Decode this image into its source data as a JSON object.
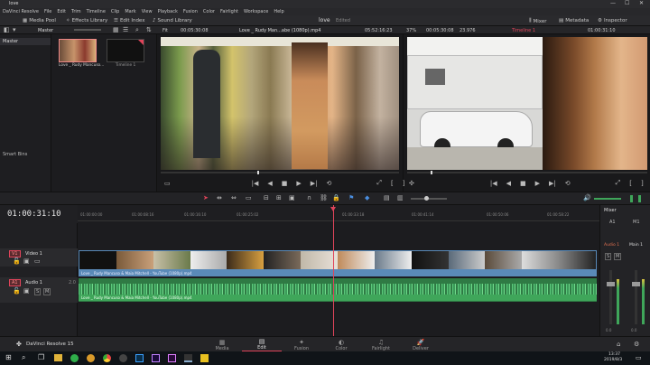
{
  "window": {
    "title": "love",
    "controls": [
      "—",
      "☐",
      "✕"
    ]
  },
  "menu": [
    "DaVinci Resolve",
    "File",
    "Edit",
    "Trim",
    "Timeline",
    "Clip",
    "Mark",
    "View",
    "Playback",
    "Fusion",
    "Color",
    "Fairlight",
    "Workspace",
    "Help"
  ],
  "toolbar": {
    "media_pool": "Media Pool",
    "effects_library": "Effects Library",
    "edit_index": "Edit Index",
    "sound_library": "Sound Library",
    "project_name": "love",
    "project_status": "Edited",
    "mixer": "Mixer",
    "metadata": "Metadata",
    "inspector": "Inspector"
  },
  "media_pool": {
    "bin_name": "Master",
    "bins": [
      "Master"
    ],
    "smart_bins": "Smart Bins",
    "clips": [
      {
        "name": "Love _ Rudy Mancuso..."
      },
      {
        "name": "Timeline 1"
      }
    ]
  },
  "source_viewer": {
    "zoom": "Fit",
    "timecode_left": "00:05:30:08",
    "clip_name": "Love _ Rudy Man...abe (1080p).mp4",
    "timecode_right": "05:52:16:23"
  },
  "program_viewer": {
    "zoom": "37%",
    "timecode_left": "00:05:30:08",
    "fps": "23.976",
    "timeline_name": "Timeline 1",
    "timecode_right": "01:00:31:10"
  },
  "timeline": {
    "timecode": "01:00:31:10",
    "ruler_ticks": [
      "01:00:00:00",
      "01:00:08:16",
      "01:00:16:10",
      "01:00:25:02",
      "01:00:33:18",
      "01:00:41:14",
      "01:00:50:06",
      "01:00:58:22"
    ],
    "video_track": {
      "id": "V1",
      "name": "Video 1",
      "clip_label": "Love _ Rudy Mancuso & Maia Mitchell - YouTube (1080p).mp4"
    },
    "audio_track": {
      "id": "A1",
      "name": "Audio 1",
      "level": "2.0",
      "clip_label": "Love _ Rudy Mancuso & Maia Mitchell - YouTube (1080p).mp4"
    }
  },
  "mixer": {
    "title": "Mixer",
    "a1": "A1",
    "m1": "M1",
    "audio1": "Audio 1",
    "main1": "Main 1",
    "value": "0.0"
  },
  "pages": [
    "Media",
    "Edit",
    "Fusion",
    "Color",
    "Fairlight",
    "Deliver"
  ],
  "active_page": "Edit",
  "branding": "DaVinci Resolve 15",
  "taskbar": {
    "time": "13:37",
    "date": "2019/8/3"
  },
  "colors": {
    "accent": "#e0445a",
    "video_clip": "#5a8ab8",
    "audio_clip": "#3fa65a",
    "playhead": "#e0445a"
  }
}
